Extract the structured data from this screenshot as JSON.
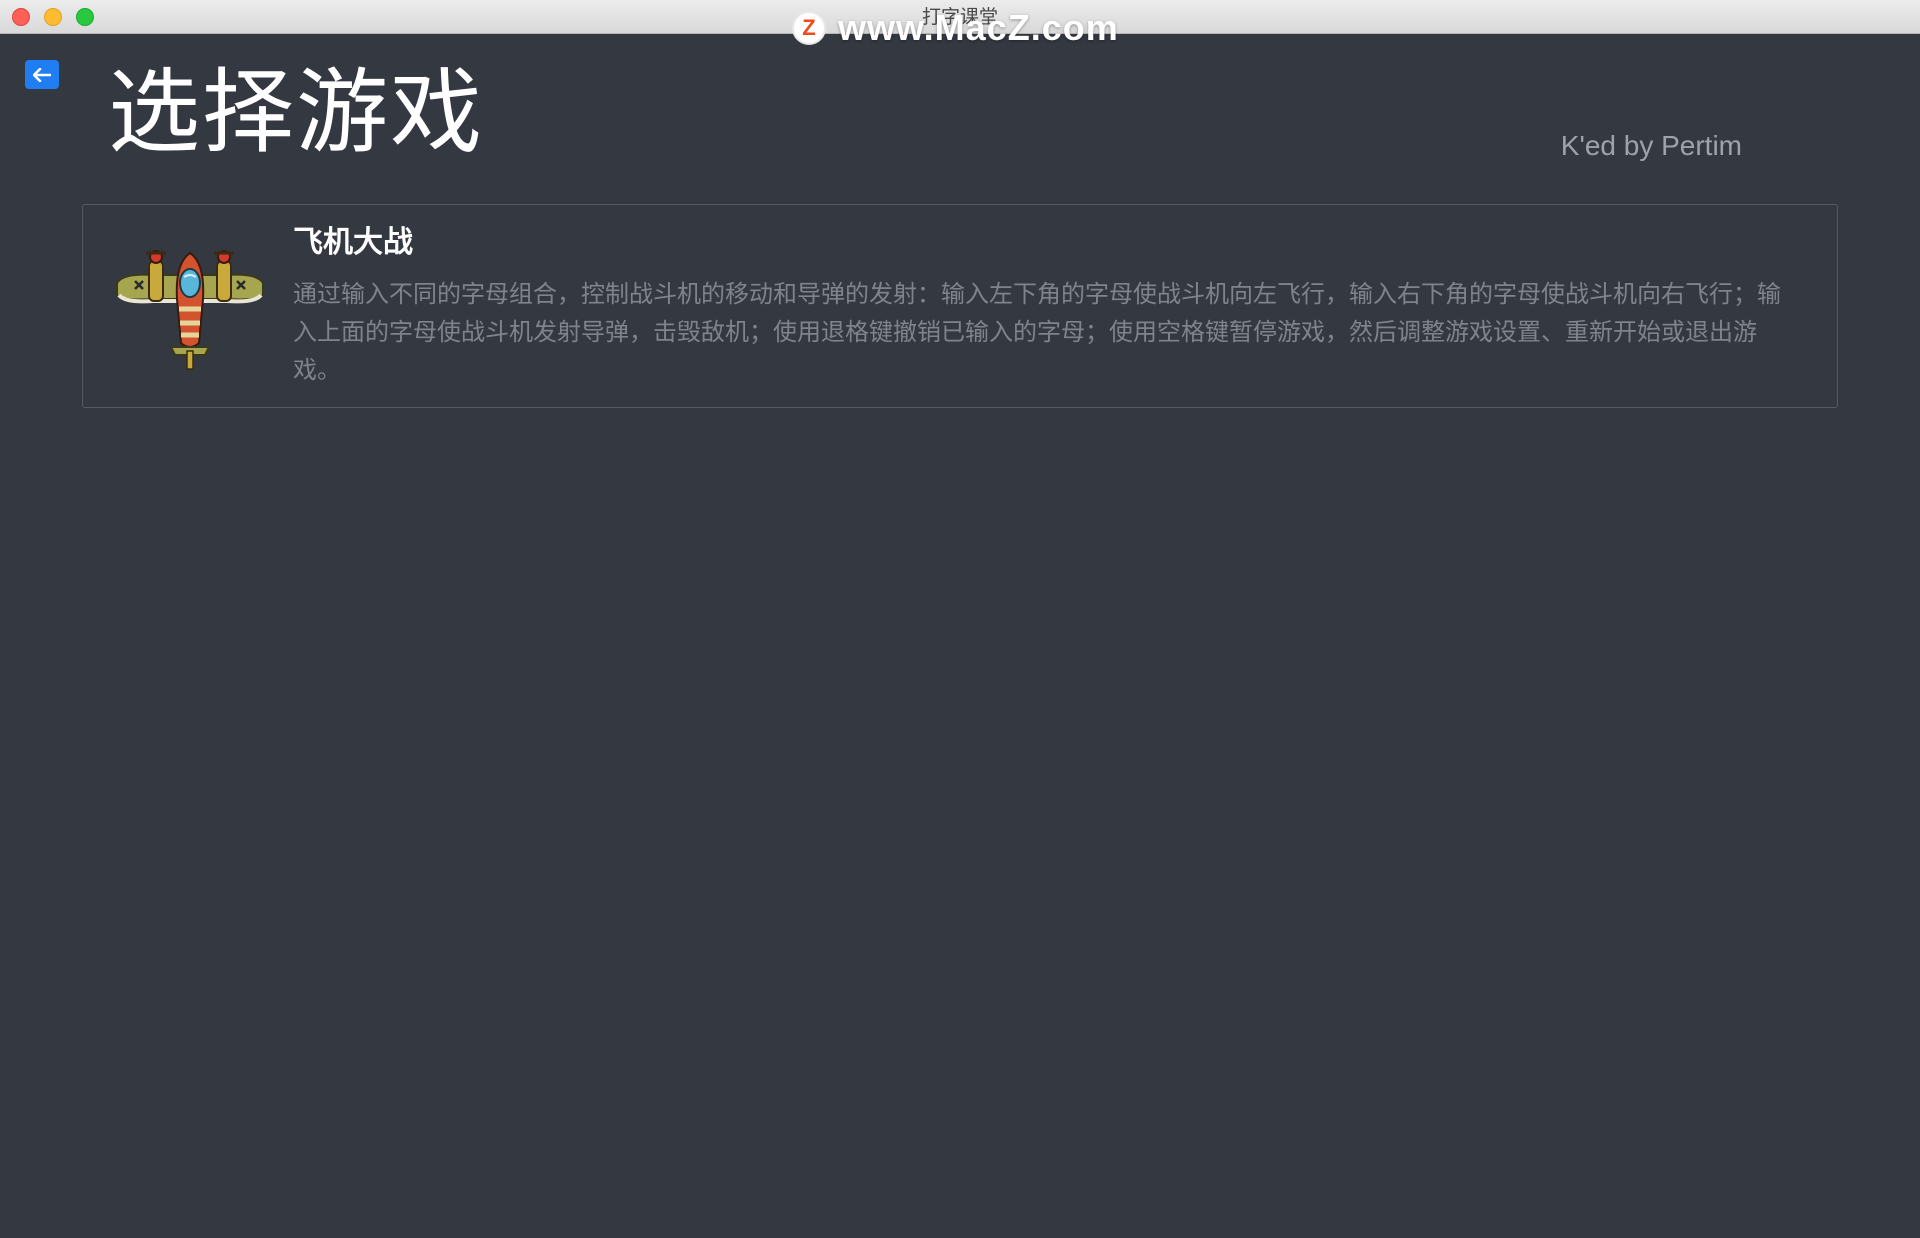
{
  "window": {
    "title": "打字课堂",
    "watermark_text": "www.MacZ.com",
    "watermark_logo": "Z"
  },
  "header": {
    "back_icon": "arrow-left-icon",
    "title": "选择游戏",
    "credit": "K'ed by Pertim"
  },
  "games": [
    {
      "title": "飞机大战",
      "icon": "airplane-icon",
      "description": "通过输入不同的字母组合，控制战斗机的移动和导弹的发射：输入左下角的字母使战斗机向左飞行，输入右下角的字母使战斗机向右飞行；输入上面的字母使战斗机发射导弹，击毁敌机；使用退格键撤销已输入的字母；使用空格键暂停游戏，然后调整游戏设置、重新开始或退出游戏。"
    }
  ],
  "colors": {
    "background": "#343841",
    "accent": "#1f7ef2",
    "card_border": "#555a63",
    "description_text": "#7f848c",
    "credit_text": "#9ea2a9"
  }
}
